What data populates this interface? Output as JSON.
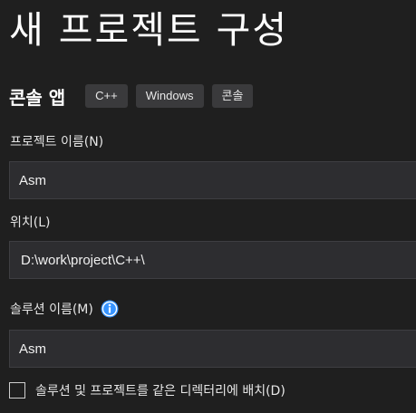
{
  "page": {
    "title": "새 프로젝트 구성"
  },
  "template": {
    "name": "콘솔 앱",
    "tags": [
      "C++",
      "Windows",
      "콘솔"
    ]
  },
  "project_name": {
    "label": "프로젝트 이름(N)",
    "value": "Asm"
  },
  "location": {
    "label": "위치(L)",
    "value": "D:\\work\\project\\C++\\"
  },
  "solution_name": {
    "label": "솔루션 이름(M)",
    "value": "Asm",
    "info_icon": "info-circle-icon",
    "info_icon_color": "#3794ff"
  },
  "same_directory": {
    "label": "솔루션 및 프로젝트를 같은 디렉터리에 배치(D)",
    "checked": false
  },
  "colors": {
    "background": "#1f1f1f",
    "field_background": "#2d2d30",
    "tag_background": "#3a3a3c",
    "accent": "#3794ff"
  }
}
